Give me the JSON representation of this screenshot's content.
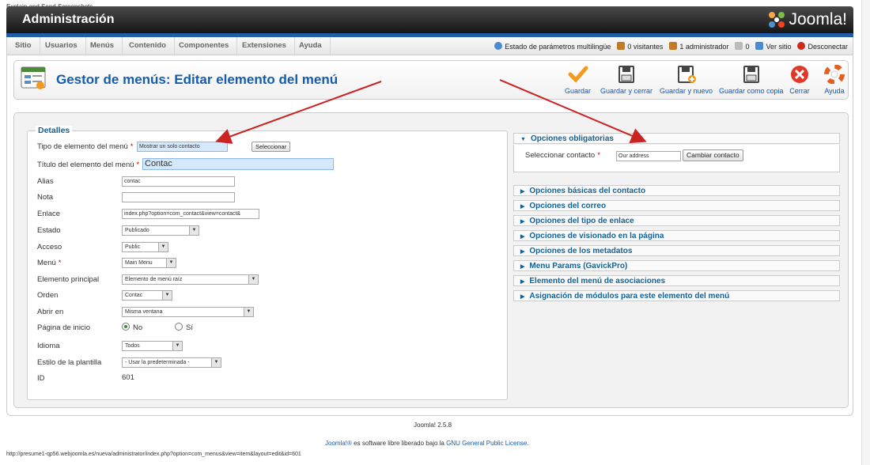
{
  "caption": "Explain and Send Screenshots",
  "header": {
    "title": "Administración",
    "logo_text": "Joomla!"
  },
  "menubar": {
    "items": [
      "Sitio",
      "Usuarios",
      "Menús",
      "Contenido",
      "Componentes",
      "Extensiones",
      "Ayuda"
    ]
  },
  "status": {
    "multilang": "Estado de parámetros multilingüe",
    "visitors": "0 visitantes",
    "admins": "1 administrador",
    "messages": "0",
    "view_site": "Ver sitio",
    "logout": "Desconectar"
  },
  "page": {
    "title": "Gestor de menús: Editar elemento del menú"
  },
  "toolbar": {
    "save": "Guardar",
    "save_close": "Guardar y cerrar",
    "save_new": "Guardar y nuevo",
    "save_copy": "Guardar como copia",
    "close": "Cerrar",
    "help": "Ayuda"
  },
  "details": {
    "legend": "Detalles",
    "type_label": "Tipo de elemento del menú",
    "type_value": "Mostrar un solo contacto",
    "select_button": "Seleccionar",
    "title_label": "Título del elemento del menú",
    "title_value": "Contac",
    "alias_label": "Alias",
    "alias_value": "contac",
    "note_label": "Nota",
    "note_value": "",
    "link_label": "Enlace",
    "link_value": "index.php?option=com_contact&view=contact&",
    "status_label": "Estado",
    "status_value": "Publicado",
    "access_label": "Acceso",
    "access_value": "Public",
    "menu_label": "Menú",
    "menu_value": "Main Menu",
    "parent_label": "Elemento principal",
    "parent_value": "Elemento de menú raíz",
    "order_label": "Orden",
    "order_value": "Contac",
    "open_label": "Abrir en",
    "open_value": "Misma ventana",
    "home_label": "Página de inicio",
    "home_no": "No",
    "home_yes": "Sí",
    "lang_label": "Idioma",
    "lang_value": "Todos",
    "style_label": "Estilo de la plantilla",
    "style_value": "- Usar la predeterminada -",
    "id_label": "ID",
    "id_value": "601"
  },
  "required_mark": "*",
  "options": {
    "required_title": "Opciones obligatorias",
    "contact_label": "Seleccionar contacto",
    "contact_value": "Our address",
    "change_button": "Cambiar contacto",
    "panels": [
      "Opciones básicas del contacto",
      "Opciones del correo",
      "Opciones del tipo de enlace",
      "Opciones de visionado en la página",
      "Opciones de los metadatos",
      "Menu Params (GavickPro)",
      "Elemento del menú de asociaciones",
      "Asignación de módulos para este elemento del menú"
    ]
  },
  "footer": {
    "version": "Joomla! 2.5.8",
    "license_prefix": "Joomla!®",
    "license_mid": "es software libre liberado bajo la",
    "license_link": "GNU General Public License",
    "license_end": "."
  },
  "statusbar": {
    "url": "http://presume1-qp56.webjoomla.es/nueva/administrator/index.php?option=com_menus&view=item&layout=edit&id=601"
  },
  "colors": {
    "accent": "#135cae",
    "header_dark": "#161616",
    "strip": "#1f5ea6",
    "arrow": "#cc2222"
  }
}
